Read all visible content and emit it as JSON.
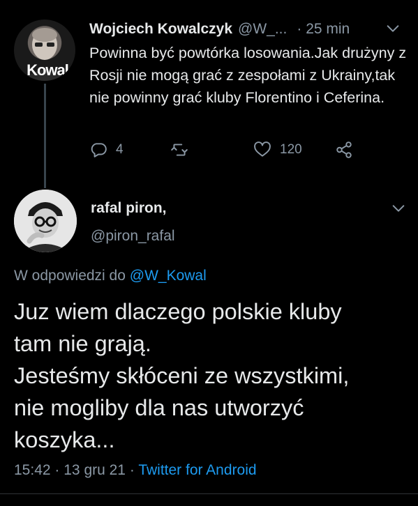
{
  "parent_tweet": {
    "author_name": "Wojciech Kowalczyk",
    "author_handle": "@W_...",
    "separator": "·",
    "time_ago": "25 min",
    "avatar_watermark": "Kowal",
    "text": "Powinna być powtórka losowania.Jak drużyny z Rosji nie mogą grać z zespołami z Ukrainy,tak nie powinny grać kluby Florentino i Ceferina.",
    "reply_count": "4",
    "like_count": "120",
    "icons": [
      "reply-icon",
      "retweet-icon",
      "like-icon",
      "share-icon",
      "chevron-down-icon"
    ]
  },
  "reply_tweet": {
    "author_name": "rafal piron,",
    "author_handle": "@piron_rafal",
    "in_reply_to_label": "W odpowiedzi do",
    "in_reply_to_handle": "@W_Kowal",
    "text_line1": "Juz wiem dlaczego polskie kluby",
    "text_line2": "tam nie grają.",
    "text_line3": "Jesteśmy skłóceni ze wszystkimi,",
    "text_line4": "nie mogliby dla nas utworzyć",
    "text_line5": "koszyka...",
    "time": "15:42",
    "date": "13 gru 21",
    "source": "Twitter for Android",
    "sep": "·"
  },
  "colors": {
    "background": "#000000",
    "text": "#e7e9ea",
    "muted": "#8b98a5",
    "link": "#1d9bf0"
  }
}
